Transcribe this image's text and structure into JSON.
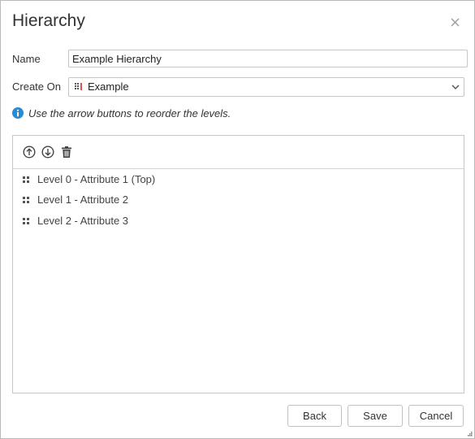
{
  "dialog": {
    "title": "Hierarchy",
    "close_icon": "close-icon"
  },
  "form": {
    "name_label": "Name",
    "name_value": "Example Hierarchy",
    "create_on_label": "Create On",
    "create_on_value": "Example",
    "create_on_icon": "table-grid-icon"
  },
  "hint": {
    "icon": "info-icon",
    "text": "Use the arrow buttons to reorder the levels.",
    "icon_color": "#2a8ad4"
  },
  "toolbar": {
    "move_up_icon": "arrow-up-circle-icon",
    "move_down_icon": "arrow-down-circle-icon",
    "delete_icon": "trash-icon"
  },
  "levels": [
    {
      "label": "Level 0 - Attribute 1 (Top)"
    },
    {
      "label": "Level 1 - Attribute 2"
    },
    {
      "label": "Level 2 - Attribute 3"
    }
  ],
  "footer": {
    "back_label": "Back",
    "save_label": "Save",
    "cancel_label": "Cancel"
  }
}
